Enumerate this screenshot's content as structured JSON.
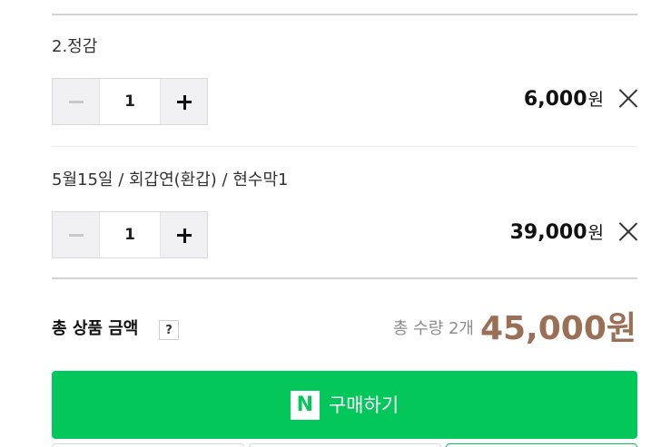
{
  "options": [
    {
      "name": "2.정감",
      "quantity": "1",
      "price": "6,000",
      "currency": "원"
    },
    {
      "name": "5월15일 / 회갑연(환갑) / 현수막1",
      "quantity": "1",
      "price": "39,000",
      "currency": "원"
    }
  ],
  "summary": {
    "label": "총 상품 금액",
    "help": "?",
    "count_text": "총 수량 2개",
    "total": "45,000원"
  },
  "buy_button": {
    "logo": "N",
    "label": "구매하기",
    "color": "#03c75a"
  },
  "colors": {
    "total_price": "#9a6f55",
    "brand_green": "#03c75a"
  },
  "icons": [
    "minus-icon",
    "plus-icon",
    "close-icon",
    "naver-n-icon"
  ]
}
